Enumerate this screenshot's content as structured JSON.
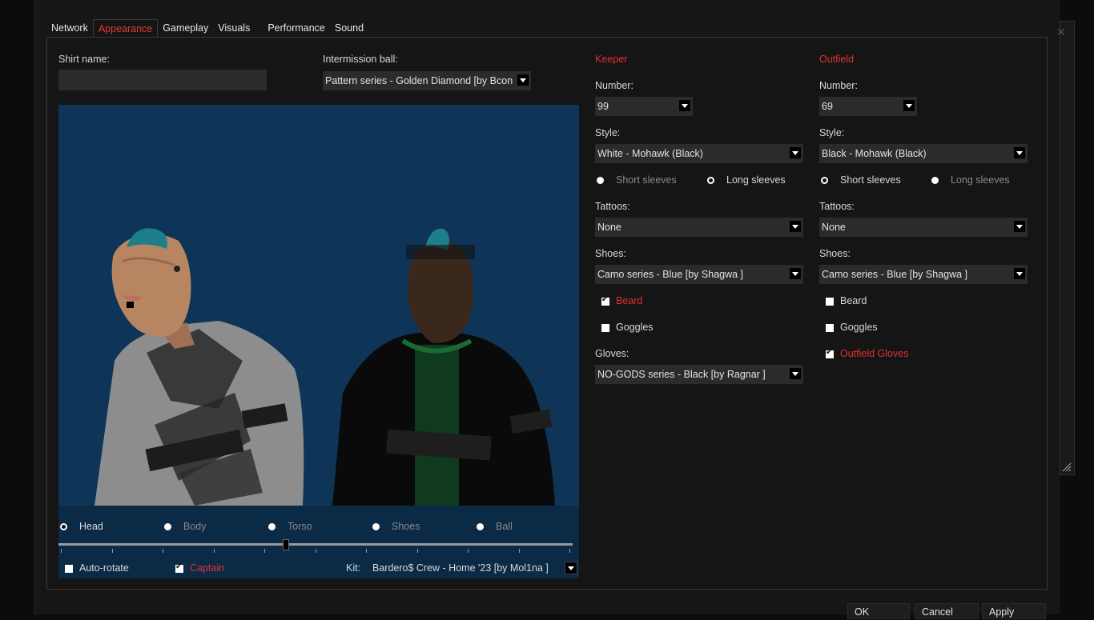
{
  "tabs": [
    {
      "label": "Network"
    },
    {
      "label": "Appearance"
    },
    {
      "label": "Gameplay"
    },
    {
      "label": "Visuals"
    },
    {
      "label": "Performance"
    },
    {
      "label": "Sound"
    }
  ],
  "active_tab": "Appearance",
  "shirt_name": {
    "label": "Shirt name:",
    "value": ""
  },
  "intermission_ball": {
    "label": "Intermission ball:",
    "value": "Pattern series - Golden Diamond   [by Bcon"
  },
  "preview": {
    "views": [
      {
        "label": "Head",
        "selected": true
      },
      {
        "label": "Body",
        "selected": false
      },
      {
        "label": "Torso",
        "selected": false
      },
      {
        "label": "Shoes",
        "selected": false
      },
      {
        "label": "Ball",
        "selected": false
      }
    ],
    "slider_fraction": 0.44,
    "auto_rotate": {
      "label": "Auto-rotate",
      "checked": false
    },
    "captain": {
      "label": "Captain",
      "checked": true
    },
    "kit": {
      "label": "Kit:",
      "value": "Bardero$ Crew - Home '23   [by Mol1na ]"
    }
  },
  "keeper": {
    "title": "Keeper",
    "number_label": "Number:",
    "number": "99",
    "style_label": "Style:",
    "style": "White - Mohawk (Black)",
    "short_sleeves": "Short sleeves",
    "long_sleeves": "Long sleeves",
    "sleeves_selected": "long",
    "tattoos_label": "Tattoos:",
    "tattoos": "None",
    "shoes_label": "Shoes:",
    "shoes": "Camo series - Blue   [by Shagwa ]",
    "beard": {
      "label": "Beard",
      "checked": true
    },
    "goggles": {
      "label": "Goggles",
      "checked": false
    },
    "gloves_label": "Gloves:",
    "gloves": "NO-GODS series - Black   [by Ragnar ]"
  },
  "outfield": {
    "title": "Outfield",
    "number_label": "Number:",
    "number": "69",
    "style_label": "Style:",
    "style": "Black - Mohawk (Black)",
    "short_sleeves": "Short sleeves",
    "long_sleeves": "Long sleeves",
    "sleeves_selected": "short",
    "tattoos_label": "Tattoos:",
    "tattoos": "None",
    "shoes_label": "Shoes:",
    "shoes": "Camo series - Blue   [by Shagwa ]",
    "beard": {
      "label": "Beard",
      "checked": false
    },
    "goggles": {
      "label": "Goggles",
      "checked": false
    },
    "gloves": {
      "label": "Outfield Gloves",
      "checked": true
    }
  },
  "buttons": {
    "ok": "OK",
    "cancel": "Cancel",
    "apply": "Apply"
  },
  "colors": {
    "accent_red": "#e03030",
    "preview_bg": "#0e3557",
    "panel_bg": "#151515"
  }
}
